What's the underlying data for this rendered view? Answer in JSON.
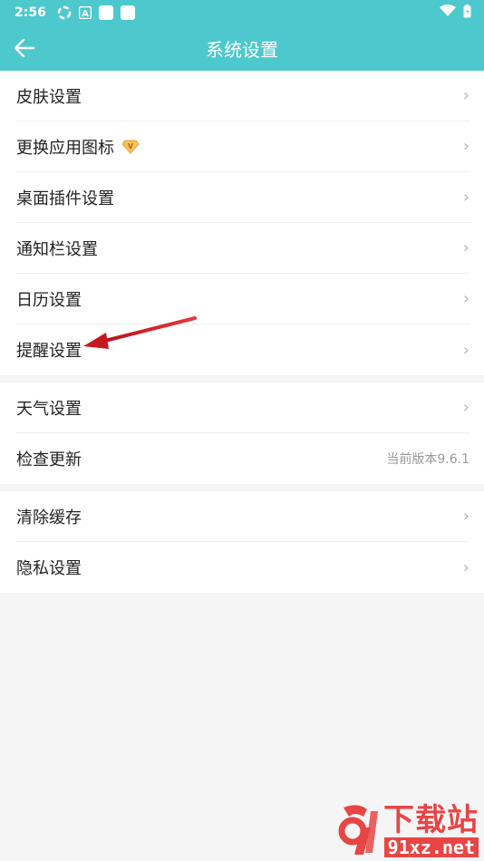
{
  "status_bar": {
    "time": "2:56",
    "app_badge": "A"
  },
  "app_bar": {
    "title": "系统设置"
  },
  "groups": [
    {
      "items": [
        {
          "label": "皮肤设置"
        },
        {
          "label": "更换应用图标",
          "badge": "V"
        },
        {
          "label": "桌面插件设置"
        },
        {
          "label": "通知栏设置"
        },
        {
          "label": "日历设置"
        },
        {
          "label": "提醒设置"
        }
      ]
    },
    {
      "items": [
        {
          "label": "天气设置"
        },
        {
          "label": "检查更新",
          "value": "当前版本9.6.1"
        }
      ]
    },
    {
      "items": [
        {
          "label": "清除缓存"
        },
        {
          "label": "隐私设置"
        }
      ]
    }
  ],
  "chevron": "›",
  "watermark": {
    "big": "下载站",
    "small": "91xz.net"
  },
  "colors": {
    "accent": "#4dc8cd",
    "annotation": "#d9242a",
    "vip": "#e8a33c"
  }
}
